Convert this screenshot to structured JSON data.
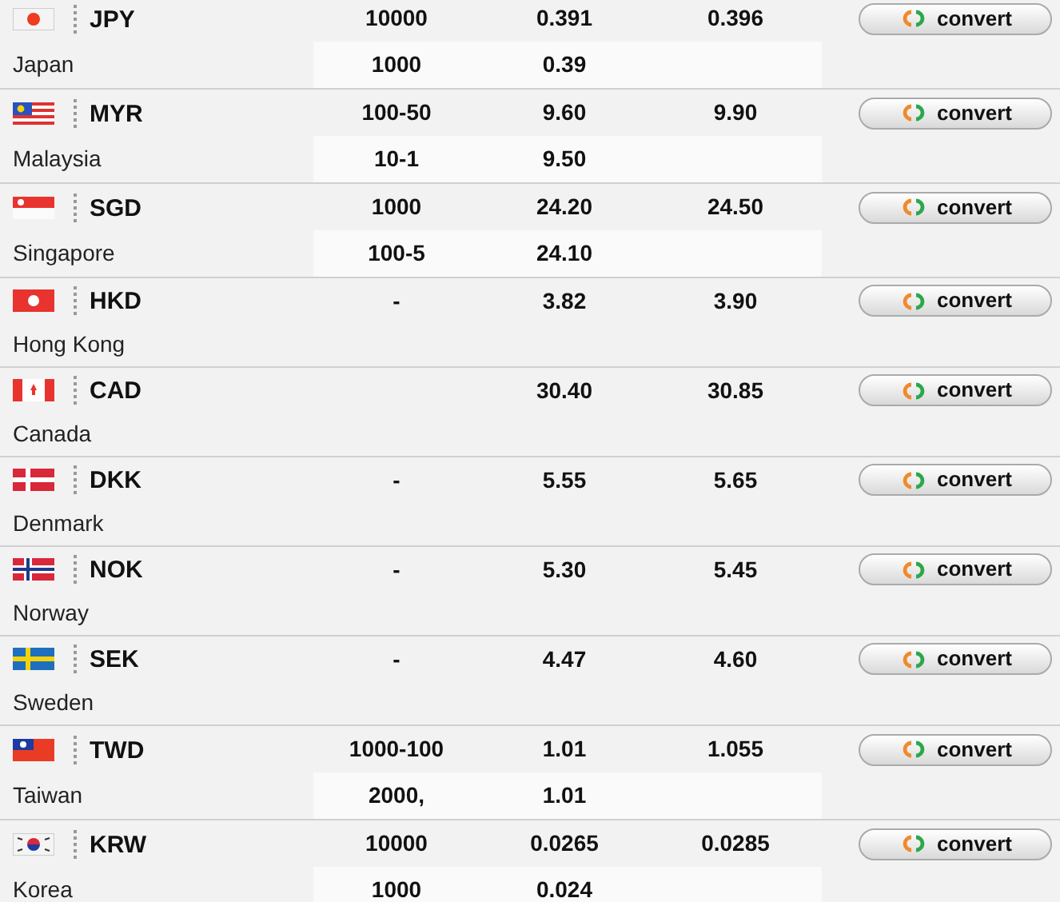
{
  "rates": [
    {
      "code": "JPY",
      "country": "Japan",
      "button": "convert",
      "tiers": [
        {
          "denomination": "10000",
          "buy": "0.391",
          "sell": "0.396"
        },
        {
          "denomination": "1000",
          "buy": "0.39"
        }
      ]
    },
    {
      "code": "MYR",
      "country": "Malaysia",
      "button": "convert",
      "tiers": [
        {
          "denomination": "100-50",
          "buy": "9.60",
          "sell": "9.90"
        },
        {
          "denomination": "10-1",
          "buy": "9.50"
        }
      ]
    },
    {
      "code": "SGD",
      "country": "Singapore",
      "button": "convert",
      "tiers": [
        {
          "denomination": "1000",
          "buy": "24.20",
          "sell": "24.50"
        },
        {
          "denomination": "100-5",
          "buy": "24.10"
        }
      ]
    },
    {
      "code": "HKD",
      "country": "Hong Kong",
      "button": "convert",
      "tiers": [
        {
          "denomination": "-",
          "buy": "3.82",
          "sell": "3.90"
        }
      ]
    },
    {
      "code": "CAD",
      "country": "Canada",
      "button": "convert",
      "tiers": [
        {
          "buy": "30.40",
          "sell": "30.85"
        }
      ]
    },
    {
      "code": "DKK",
      "country": "Denmark",
      "button": "convert",
      "tiers": [
        {
          "denomination": "-",
          "buy": "5.55",
          "sell": "5.65"
        }
      ]
    },
    {
      "code": "NOK",
      "country": "Norway",
      "button": "convert",
      "tiers": [
        {
          "denomination": "-",
          "buy": "5.30",
          "sell": "5.45"
        }
      ]
    },
    {
      "code": "SEK",
      "country": "Sweden",
      "button": "convert",
      "tiers": [
        {
          "denomination": "-",
          "buy": "4.47",
          "sell": "4.60"
        }
      ]
    },
    {
      "code": "TWD",
      "country": "Taiwan",
      "button": "convert",
      "tiers": [
        {
          "denomination": "1000-100",
          "buy": "1.01",
          "sell": "1.055"
        },
        {
          "denomination": "2000,",
          "buy": "1.01"
        }
      ]
    },
    {
      "code": "KRW",
      "country": "Korea",
      "button": "convert",
      "tiers": [
        {
          "denomination": "10000",
          "buy": "0.0265",
          "sell": "0.0285"
        },
        {
          "denomination": "1000",
          "buy": "0.024"
        }
      ]
    }
  ]
}
